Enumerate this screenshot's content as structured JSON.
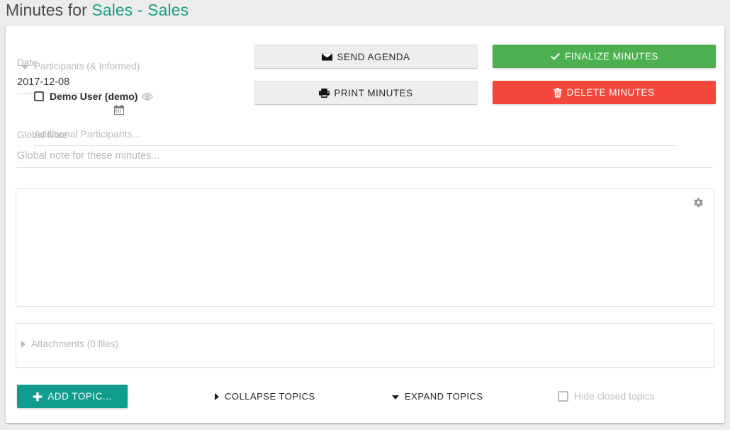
{
  "page": {
    "title_prefix": "Minutes for ",
    "title_accent": "Sales - Sales"
  },
  "date_field": {
    "label": "Date",
    "value": "2017-12-08",
    "icon": "calendar-icon"
  },
  "actions": {
    "send_agenda": {
      "label": "SEND AGENDA",
      "icon": "envelope-icon",
      "color": "#eeeeee"
    },
    "print_minutes": {
      "label": "PRINT MINUTES",
      "icon": "printer-icon",
      "color": "#eeeeee"
    },
    "finalize_minutes": {
      "label": "FINALIZE MINUTES",
      "icon": "check-icon",
      "color": "#4caf50"
    },
    "delete_minutes": {
      "label": "DELETE MINUTES",
      "icon": "trash-icon",
      "color": "#f4483c"
    }
  },
  "global_note": {
    "label": "Global Note",
    "value": "",
    "placeholder": "Global note for these minutes..."
  },
  "participants_panel": {
    "header": "Participants (& Informed)",
    "expanded": true,
    "settings_icon": "gear-icon",
    "rows": [
      {
        "name": "Demo User (demo)",
        "checked": false,
        "watch_icon": "eye-icon"
      }
    ],
    "additional": {
      "value": "",
      "placeholder": "Additional Participants..."
    }
  },
  "attachments_panel": {
    "header": "Attachments (0 files)",
    "expanded": false,
    "file_count": 0
  },
  "bottom_bar": {
    "add_topic": {
      "label": "ADD TOPIC...",
      "icon": "plus-icon",
      "color": "#119d8d"
    },
    "collapse_topics": {
      "label": "COLLAPSE TOPICS",
      "icon": "triangle-right-icon"
    },
    "expand_topics": {
      "label": "EXPAND TOPICS",
      "icon": "triangle-down-icon"
    },
    "hide_closed_topics": {
      "label": "Hide closed topics",
      "checked": false
    }
  },
  "theme": {
    "accent": "#1a9e86",
    "teal": "#119d8d",
    "green": "#4caf50",
    "red": "#f4483c",
    "page_bg": "#ececec",
    "card_bg": "#ffffff"
  }
}
